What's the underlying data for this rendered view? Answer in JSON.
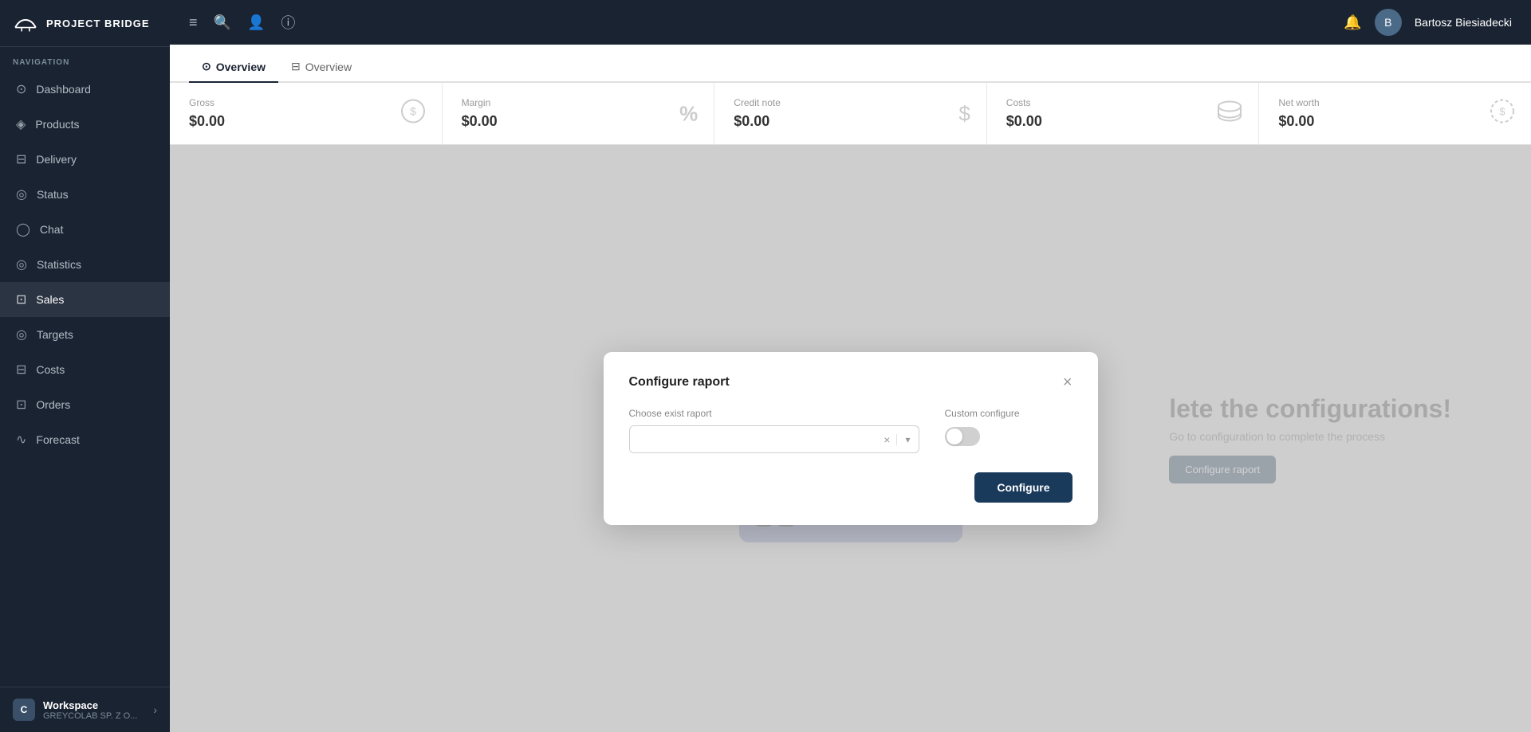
{
  "app": {
    "title": "PROJECT BRIDGE",
    "logo_symbol": "🌉"
  },
  "header": {
    "user_name": "Bartosz Biesiadecki",
    "notification_icon": "🔔",
    "menu_icon": "≡",
    "search_icon": "🔍",
    "person_icon": "👤",
    "info_icon": "ⓘ"
  },
  "sidebar": {
    "nav_label": "NAVIGATION",
    "items": [
      {
        "id": "dashboard",
        "label": "Dashboard",
        "icon": "⊙"
      },
      {
        "id": "products",
        "label": "Products",
        "icon": "◈"
      },
      {
        "id": "delivery",
        "label": "Delivery",
        "icon": "🚚",
        "icon_char": "⊟"
      },
      {
        "id": "status",
        "label": "Status",
        "icon": "◎"
      },
      {
        "id": "chat",
        "label": "Chat",
        "icon": "◯"
      },
      {
        "id": "statistics",
        "label": "Statistics",
        "icon": "◎"
      },
      {
        "id": "sales",
        "label": "Sales",
        "icon": "⊡"
      },
      {
        "id": "targets",
        "label": "Targets",
        "icon": "◎"
      },
      {
        "id": "costs",
        "label": "Costs",
        "icon": "⊟"
      },
      {
        "id": "orders",
        "label": "Orders",
        "icon": "⊡"
      },
      {
        "id": "forecast",
        "label": "Forecast",
        "icon": "∿"
      }
    ],
    "workspace": {
      "initial": "C",
      "name": "Workspace",
      "sub": "GREYCOLAB SP. Z O..."
    }
  },
  "tabs": [
    {
      "id": "overview1",
      "label": "Overview",
      "icon": "⊙",
      "active": true
    },
    {
      "id": "overview2",
      "label": "Overview",
      "icon": "⊟",
      "active": false
    }
  ],
  "stats": [
    {
      "id": "gross",
      "label": "Gross",
      "value": "$0.00",
      "icon": "💲"
    },
    {
      "id": "margin",
      "label": "Margin",
      "value": "$0.00",
      "icon": "%"
    },
    {
      "id": "credit_note",
      "label": "Credit note",
      "value": "$0.00",
      "icon": "$"
    },
    {
      "id": "costs",
      "label": "Costs",
      "value": "$0.00",
      "icon": "🏦"
    },
    {
      "id": "net_worth",
      "label": "Net worth",
      "value": "$0.00",
      "icon": "💲"
    }
  ],
  "info_panel": {
    "title": "lete the configurations!",
    "subtitle": "Go to configuration to complete the process",
    "button_label": "Configure raport"
  },
  "modal": {
    "title": "Configure raport",
    "choose_label": "Choose exist raport",
    "custom_label": "Custom configure",
    "select_placeholder": "",
    "configure_button": "Configure",
    "close_icon": "×"
  }
}
